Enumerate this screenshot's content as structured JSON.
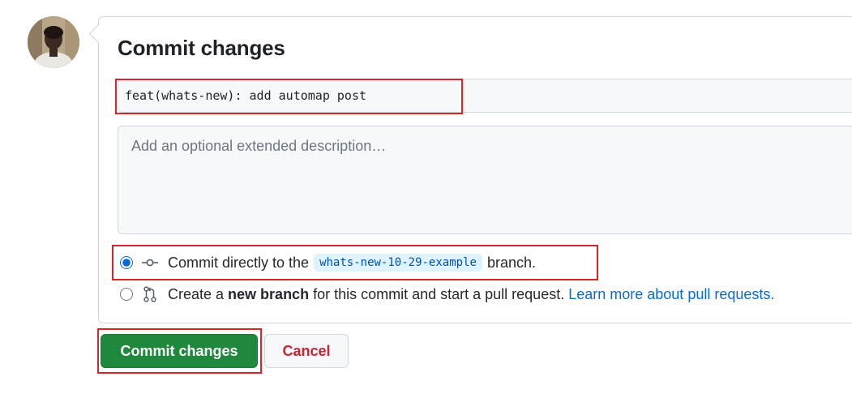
{
  "commit_form": {
    "title": "Commit changes",
    "summary_value": "feat(whats-new): add automap post",
    "description_placeholder": "Add an optional extended description…"
  },
  "options": {
    "direct": {
      "text_before": "Commit directly to the",
      "branch": "whats-new-10-29-example",
      "text_after": "branch.",
      "selected": true,
      "icon": "git-commit-icon"
    },
    "new_branch": {
      "text_before": "Create a",
      "strong": "new branch",
      "text_after": "for this commit and start a pull request.",
      "link": "Learn more about pull requests.",
      "selected": false,
      "icon": "git-pull-request-icon"
    }
  },
  "buttons": {
    "commit": "Commit changes",
    "cancel": "Cancel"
  },
  "colors": {
    "primary_button": "#1f883d",
    "cancel_text": "#cf222e",
    "link": "#0969da",
    "highlight_box": "#d6262a"
  }
}
